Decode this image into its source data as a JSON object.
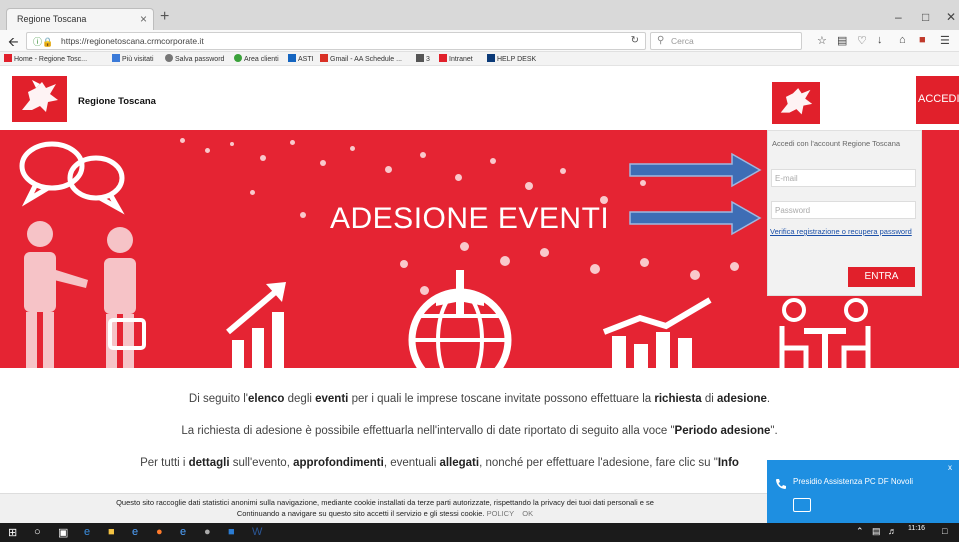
{
  "browser": {
    "tab_title": "Regione Toscana",
    "tab_close": "×",
    "new_tab": "+",
    "url": "https://regionetoscana.crmcorporate.it",
    "search_placeholder": "Cerca",
    "bookmarks": [
      "Home - Regione Tosc...",
      "Più visitati",
      "Salva password",
      "Area clienti",
      "ASTI",
      "Gmail - AA Schedule ...",
      "3",
      "Intranet",
      "HELP DESK"
    ]
  },
  "header": {
    "brand": "Regione Toscana"
  },
  "hero": {
    "title": "ADESIONE EVENTI"
  },
  "login": {
    "accedi_label": "ACCEDI",
    "intro": "Accedi con l'account Regione Toscana",
    "email_placeholder": "E-mail",
    "password_placeholder": "Password",
    "verify_link": "Verifica registrazione o recupera password",
    "submit_label": "ENTRA"
  },
  "content": {
    "p1": {
      "a": "Di seguito l'",
      "b": "elenco",
      "c": " degli ",
      "d": "eventi",
      "e": " per i quali le imprese toscane invitate possono effettuare la ",
      "f": "richiesta",
      "g": " di ",
      "h": "adesione",
      "i": "."
    },
    "p2": {
      "a": "La richiesta di adesione è possibile effettuarla nell'intervallo di date riportato di seguito alla voce \"",
      "b": "Periodo adesione",
      "c": "\"."
    },
    "p3": {
      "a": "Per tutti i ",
      "b": "dettagli",
      "c": " sull'evento, ",
      "d": "approfondimenti",
      "e": ", eventuali ",
      "f": "allegati",
      "g": ", nonché per effettuare l'adesione, fare clic su \"",
      "h": "Info"
    }
  },
  "cookie": {
    "line1": "Questo sito raccoglie dati statistici anonimi sulla navigazione, mediante cookie installati da terze parti autorizzate, rispettando la privacy dei tuoi dati personali e se",
    "line2": "Continuando a navigare su questo sito accetti il servizio e gli stessi cookie.",
    "policy": "POLICY",
    "ok": "OK"
  },
  "chat": {
    "title": "Presidio Assistenza PC DF Novoli",
    "close": "x"
  },
  "taskbar": {
    "time": "11:16"
  },
  "colors": {
    "brand_red": "#e52433",
    "chat_blue": "#1e8fe1",
    "arrow_blue": "#3e6db5"
  }
}
